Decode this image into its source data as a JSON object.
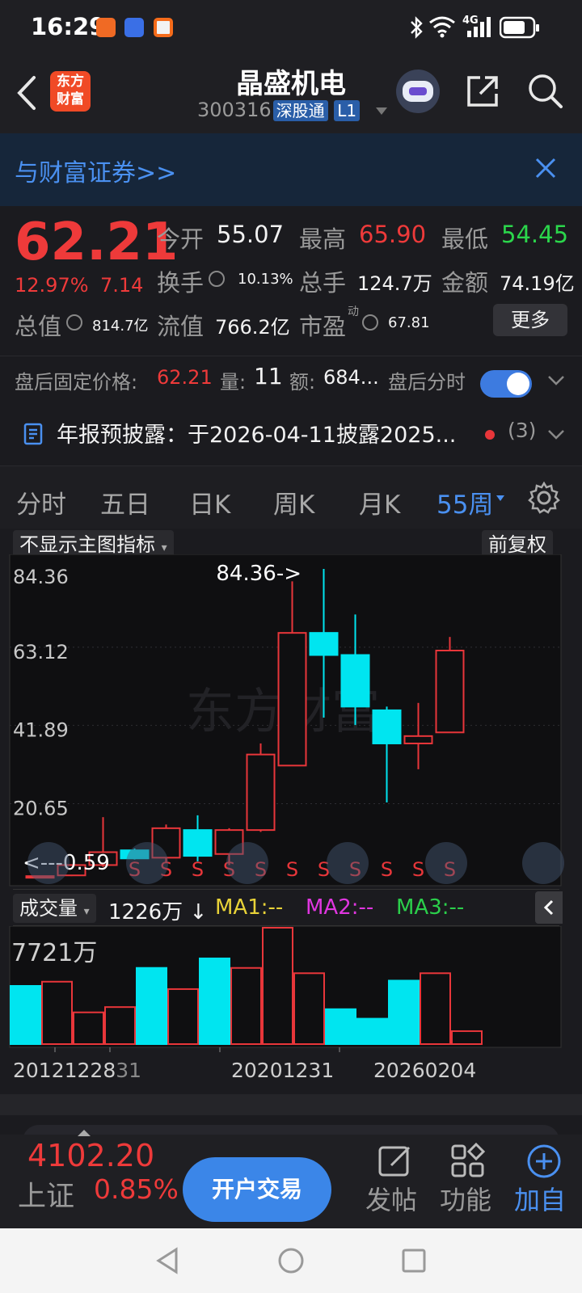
{
  "status_bar": {
    "time": "16:29",
    "network": "4G"
  },
  "header": {
    "logo_line1": "东方",
    "logo_line2": "财富",
    "title": "晶盛机电",
    "code": "300316",
    "tag_connect": "深股通",
    "tag_level": "L1"
  },
  "banner": {
    "text": "与财富证券>>"
  },
  "quote": {
    "price": "62.21",
    "change_pct": "12.97%",
    "change": "7.14",
    "open_label": "今开",
    "open": "55.07",
    "high_label": "最高",
    "high": "65.90",
    "low_label": "最低",
    "low": "54.45",
    "turnover_label": "换手",
    "turnover": "10.13%",
    "volume_label": "总手",
    "volume": "124.7万",
    "amount_label": "金额",
    "amount": "74.19亿",
    "mcap_label": "总值",
    "mcap": "814.7亿",
    "float_label": "流值",
    "float": "766.2亿",
    "pe_label": "市盈",
    "pe_sup": "动",
    "pe": "67.81",
    "more": "更多"
  },
  "after_hours": {
    "label": "盘后固定价格:",
    "price": "62.21",
    "vol_label": "量:",
    "vol": "11",
    "amt_label": "额:",
    "amt": "684...",
    "toggle_label": "盘后分时"
  },
  "notice": {
    "text": "年报预披露：于2026-04-11披露2025...",
    "count": "(3)"
  },
  "periods": [
    {
      "label": "分时"
    },
    {
      "label": "五日"
    },
    {
      "label": "日K"
    },
    {
      "label": "周K"
    },
    {
      "label": "月K"
    },
    {
      "label": "55周"
    }
  ],
  "chart_controls": {
    "indicator": "不显示主图指标",
    "adjust": "前复权",
    "watermark": "东方财富"
  },
  "y_labels": [
    "84.36",
    "63.12",
    "41.89",
    "20.65"
  ],
  "annotations": {
    "max": "84.36->",
    "min": "<---0.59"
  },
  "s_mark": "S",
  "volume_panel": {
    "label": "成交量",
    "current": "1226万",
    "arrow": "↓",
    "ma1": "MA1:--",
    "ma2": "MA2:--",
    "ma3": "MA3:--",
    "max_label": "7721万"
  },
  "x_labels": [
    "20121228",
    "31",
    "20201231",
    "20260204"
  ],
  "colors": {
    "up": "#e8363a",
    "down": "#00e5f0",
    "accent": "#3d7be0"
  },
  "chart_data": {
    "type": "candlestick",
    "ylim": [
      0.59,
      84.36
    ],
    "candles": [
      {
        "o": 0.8,
        "c": 1.0,
        "h": 1.0,
        "l": 0.59
      },
      {
        "o": 1.2,
        "c": 4.0,
        "h": 4.0,
        "l": 1.0
      },
      {
        "o": 4.0,
        "c": 7.5,
        "h": 17.0,
        "l": 3.5
      },
      {
        "o": 8.0,
        "c": 5.8,
        "h": 8.5,
        "l": 5.5
      },
      {
        "o": 6.0,
        "c": 14.0,
        "h": 15.0,
        "l": 4.5
      },
      {
        "o": 13.5,
        "c": 6.5,
        "h": 17.5,
        "l": 5.0
      },
      {
        "o": 7.0,
        "c": 13.5,
        "h": 14.0,
        "l": 4.0
      },
      {
        "o": 13.5,
        "c": 34.0,
        "h": 37.0,
        "l": 13.0
      },
      {
        "o": 31.0,
        "c": 67.0,
        "h": 81.0,
        "l": 31.0
      },
      {
        "o": 67.0,
        "c": 61.0,
        "h": 84.36,
        "l": 44.0
      },
      {
        "o": 61.0,
        "c": 47.0,
        "h": 72.0,
        "l": 42.0
      },
      {
        "o": 46.0,
        "c": 37.0,
        "h": 47.0,
        "l": 21.0
      },
      {
        "o": 37.0,
        "c": 39.0,
        "h": 48.0,
        "l": 30.0
      },
      {
        "o": 40.0,
        "c": 62.21,
        "h": 65.9,
        "l": 40.0
      }
    ],
    "volume": [
      {
        "v": 5500,
        "up": false
      },
      {
        "v": 5900,
        "up": true
      },
      {
        "v": 3000,
        "up": true
      },
      {
        "v": 3500,
        "up": true
      },
      {
        "v": 7200,
        "up": false
      },
      {
        "v": 5200,
        "up": true
      },
      {
        "v": 8100,
        "up": false
      },
      {
        "v": 7200,
        "up": true
      },
      {
        "v": 11000,
        "up": true
      },
      {
        "v": 6700,
        "up": true
      },
      {
        "v": 3300,
        "up": false
      },
      {
        "v": 2400,
        "up": false
      },
      {
        "v": 6000,
        "up": false
      },
      {
        "v": 6700,
        "up": true
      },
      {
        "v": 1226,
        "up": true
      }
    ]
  },
  "bottom_bar": {
    "index_value": "4102.20",
    "index_name": "上证",
    "index_pct": "0.85%",
    "open_account": "开户交易",
    "post": "发帖",
    "functions": "功能",
    "add": "加自"
  }
}
